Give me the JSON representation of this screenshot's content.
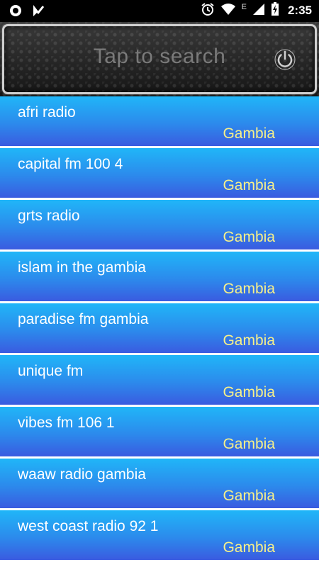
{
  "status_bar": {
    "time": "2:35",
    "network_label": "E",
    "icons": [
      "record-icon",
      "app-notification-icon",
      "alarm-icon",
      "wifi-icon",
      "signal-icon",
      "battery-charging-icon"
    ]
  },
  "header": {
    "search_placeholder": "Tap to search",
    "power_icon": "power-icon"
  },
  "stations": [
    {
      "name": "afri radio",
      "country": "Gambia"
    },
    {
      "name": "capital fm 100 4",
      "country": "Gambia"
    },
    {
      "name": "grts radio",
      "country": "Gambia"
    },
    {
      "name": "islam in the gambia",
      "country": "Gambia"
    },
    {
      "name": "paradise fm gambia",
      "country": "Gambia"
    },
    {
      "name": "unique fm",
      "country": "Gambia"
    },
    {
      "name": "vibes fm 106 1",
      "country": "Gambia"
    },
    {
      "name": "waaw radio gambia",
      "country": "Gambia"
    },
    {
      "name": "west coast radio 92 1",
      "country": "Gambia"
    }
  ],
  "colors": {
    "row_top": "#20b6f8",
    "row_bottom": "#3a5be0",
    "country_text": "#f6f08a",
    "name_text": "#ffffff"
  }
}
